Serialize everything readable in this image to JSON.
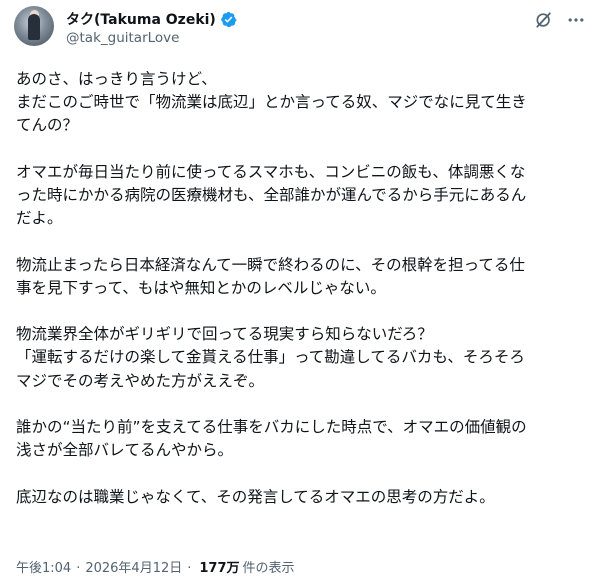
{
  "author": {
    "display_name": "タク(Takuma Ozeki)",
    "handle": "@tak_guitarLove",
    "verified_color": "#1d9bf0"
  },
  "icons": {
    "avatar": "avatar",
    "verified": "verified-badge-icon",
    "grok": "grok-icon",
    "more": "more-icon"
  },
  "post": {
    "paragraphs": [
      {
        "lines": [
          "あのさ、はっきり言うけど、",
          "まだこのご時世で「物流業は底辺」とか言ってる奴、マジでなに見て生き",
          "てんの？"
        ]
      },
      {
        "lines": [
          "オマエが毎日当たり前に使ってるスマホも、コンビニの飯も、体調悪くな",
          "った時にかかる病院の医療機材も、全部誰かが運んでるから手元にあるん",
          "だよ。"
        ]
      },
      {
        "lines": [
          "物流止まったら日本経済なんて一瞬で終わるのに、その根幹を担ってる仕",
          "事を見下すって、もはや無知とかのレベルじゃない。"
        ]
      },
      {
        "lines": [
          "物流業界全体がギリギリで回ってる現実すら知らないだろ？",
          "「運転するだけの楽して金貰える仕事」って勘違してるバカも、そろそろ",
          "マジでその考えやめた方がええぞ。"
        ]
      },
      {
        "lines": [
          "誰かの“当たり前”を支えてる仕事をバカにした時点で、オマエの価値観の",
          "浅さが全部バレてるんやから。"
        ]
      },
      {
        "lines": [
          "底辺なのは職業じゃなくて、その発言してるオマエの思考の方だよ。"
        ]
      }
    ]
  },
  "meta": {
    "time": "午後1:04",
    "separator": "·",
    "date": "2026年4月12日",
    "views": "177万",
    "views_label": "件の表示"
  }
}
